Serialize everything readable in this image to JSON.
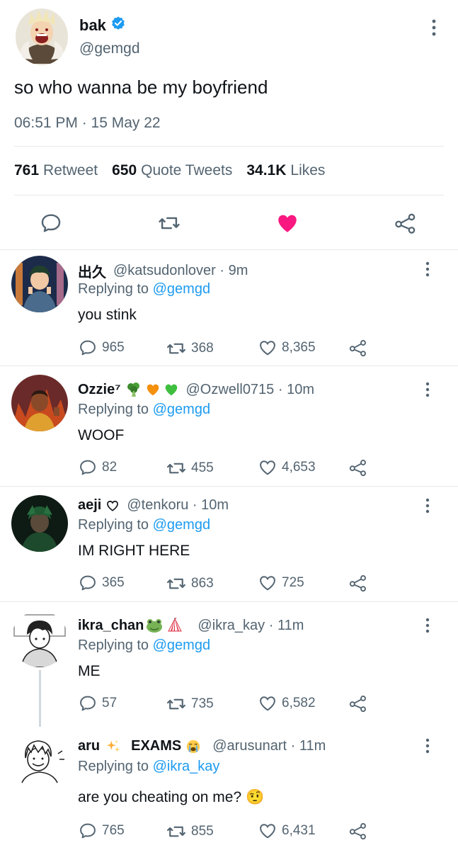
{
  "main_tweet": {
    "author_name": "bak",
    "handle": "@gemgd",
    "verified": true,
    "text": "so who wanna be my boyfriend",
    "timestamp": "06:51 PM · 15 May 22",
    "stats": [
      {
        "count": "761",
        "label": "Retweet"
      },
      {
        "count": "650",
        "label": "Quote Tweets"
      },
      {
        "count": "34.1K",
        "label": "Likes"
      }
    ],
    "liked": true,
    "colors": {
      "like": "#f91880",
      "verified": "#1d9bf0",
      "link": "#1d9bf0"
    }
  },
  "replies": [
    {
      "name": "出久",
      "decorations": [],
      "handle_time": "@katsudonlover · 9m",
      "replying_prefix": "Replying to ",
      "replying_to": "@gemgd",
      "text": "you stink",
      "counts": {
        "replies": "965",
        "retweets": "368",
        "likes": "8,365"
      }
    },
    {
      "name": "Ozzie⁷",
      "decorations": [
        "broccoli",
        "orange-heart",
        "green-heart"
      ],
      "handle_time": "@Ozwell0715 · 10m",
      "replying_prefix": "Replying to ",
      "replying_to": "@gemgd",
      "text": "WOOF",
      "counts": {
        "replies": "82",
        "retweets": "455",
        "likes": "4,653"
      }
    },
    {
      "name": "aeji",
      "decorations": [
        "white-heart"
      ],
      "handle_time": "@tenkoru · 10m",
      "replying_prefix": "Replying to ",
      "replying_to": "@gemgd",
      "text": "IM RIGHT HERE",
      "counts": {
        "replies": "365",
        "retweets": "863",
        "likes": "725"
      }
    },
    {
      "name": "ikra_chan",
      "decorations": [
        "frog",
        "circus-tent"
      ],
      "handle_time": "@ikra_kay · 11m",
      "replying_prefix": "Replying to ",
      "replying_to": "@gemgd",
      "text": "ME",
      "counts": {
        "replies": "57",
        "retweets": "735",
        "likes": "6,582"
      }
    },
    {
      "name": "aru",
      "name_suffix": "EXAMS",
      "decorations": [
        "sparkles",
        "crying-face"
      ],
      "handle_time": "@arusunart · 11m",
      "replying_prefix": "Replying to ",
      "replying_to": "@ikra_kay",
      "text": "are you cheating on me? 🤨",
      "counts": {
        "replies": "765",
        "retweets": "855",
        "likes": "6,431"
      }
    }
  ]
}
